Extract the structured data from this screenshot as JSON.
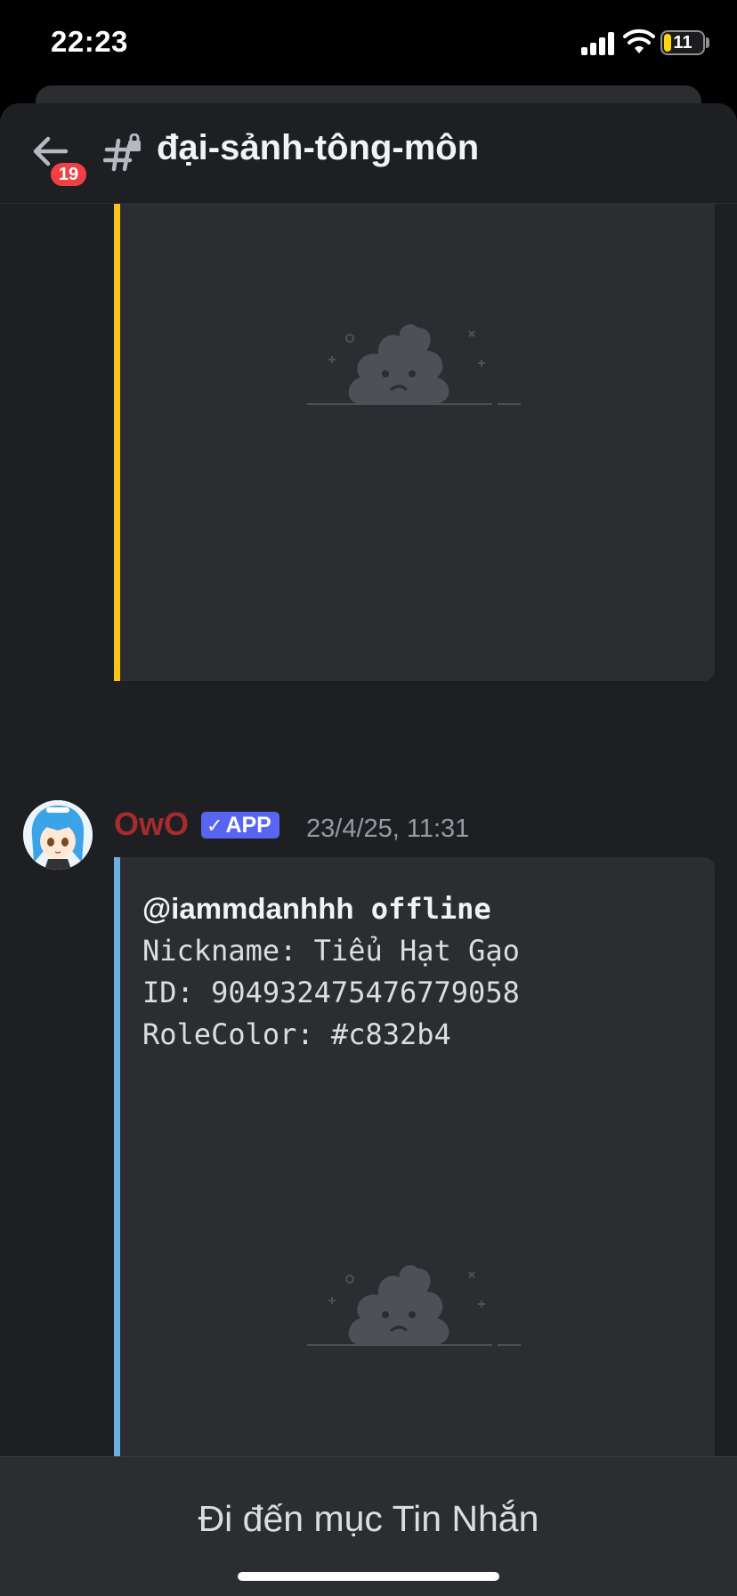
{
  "status_bar": {
    "time": "22:23",
    "battery": "11"
  },
  "header": {
    "back_badge": "19",
    "channel_name": "đại-sảnh-tông-môn"
  },
  "message": {
    "author": "OwO",
    "app_tag": "APP",
    "timestamp": "23/4/25, 11:31",
    "embed": {
      "username": "@iammdanhhh",
      "status": "offline",
      "nickname_line": "Nickname: Tiểu Hạt Gạo",
      "id_line": "ID: 904932475476779058",
      "rolecolor_line": "RoleColor: #c832b4"
    }
  },
  "footer": {
    "button_label": "Đi đến mục Tin Nhắn"
  },
  "colors": {
    "embed1_bar": "#fcc419",
    "embed2_bar": "#6ab0e4",
    "author": "#a52b2f",
    "app_tag": "#5865f2",
    "badge": "#f23f43"
  },
  "icons": [
    "back-arrow-icon",
    "channel-hash-lock-icon",
    "image-placeholder-icon",
    "wifi-icon",
    "signal-icon",
    "battery-icon",
    "verified-check-icon"
  ]
}
